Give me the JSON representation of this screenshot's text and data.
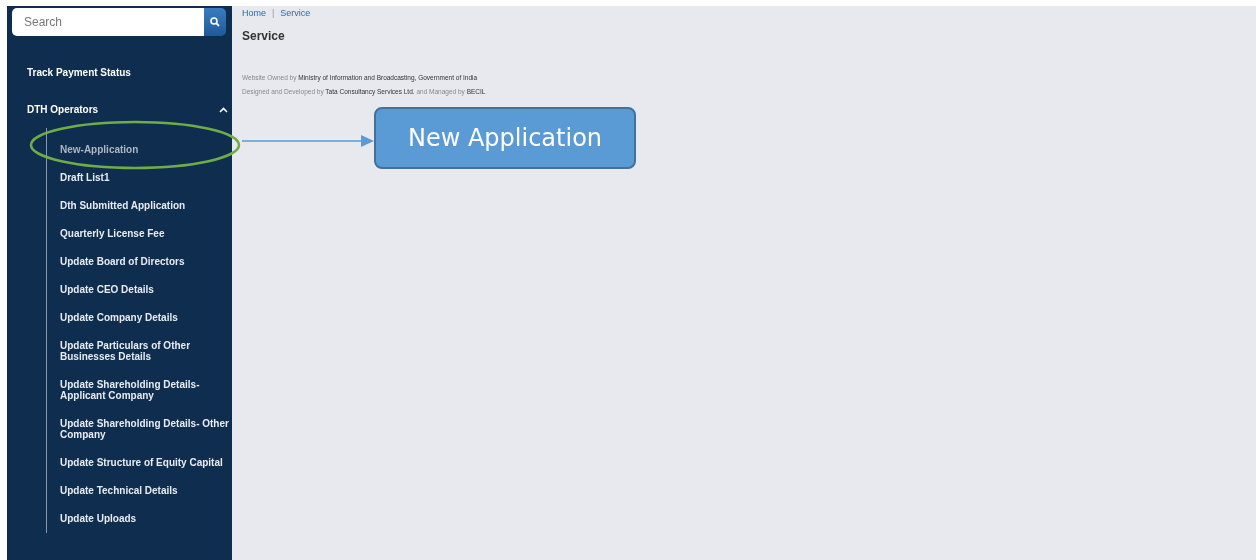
{
  "sidebar": {
    "search": {
      "placeholder": "Search"
    },
    "items": [
      {
        "label": "Track Payment Status"
      },
      {
        "label": "DTH Operators",
        "expanded": true,
        "children": [
          {
            "label": "New-Application",
            "selected": true
          },
          {
            "label": "Draft List1",
            "selected": false
          },
          {
            "label": "Dth Submitted Application",
            "selected": false
          },
          {
            "label": "Quarterly License Fee",
            "selected": false
          },
          {
            "label": "Update Board of Directors",
            "selected": false
          },
          {
            "label": "Update CEO Details",
            "selected": false
          },
          {
            "label": "Update Company Details",
            "selected": false
          },
          {
            "label": "Update Particulars of Other Businesses Details",
            "selected": false
          },
          {
            "label": "Update Shareholding Details- Applicant Company",
            "selected": false
          },
          {
            "label": "Update Shareholding Details- Other Company",
            "selected": false
          },
          {
            "label": "Update Structure of Equity Capital",
            "selected": false
          },
          {
            "label": "Update Technical Details",
            "selected": false
          },
          {
            "label": "Update Uploads",
            "selected": false
          }
        ]
      }
    ]
  },
  "breadcrumb": {
    "separator": "|",
    "links": [
      "Home",
      "Service"
    ]
  },
  "page_title": "Service",
  "footer": [
    "Website Owned by **Ministry of Information and Broadcasting, Government of India**",
    "Designed and Developed by **Tata Consultancy Services Ltd.** and Managed by **BECIL**"
  ],
  "callout": {
    "label": "New Application"
  }
}
